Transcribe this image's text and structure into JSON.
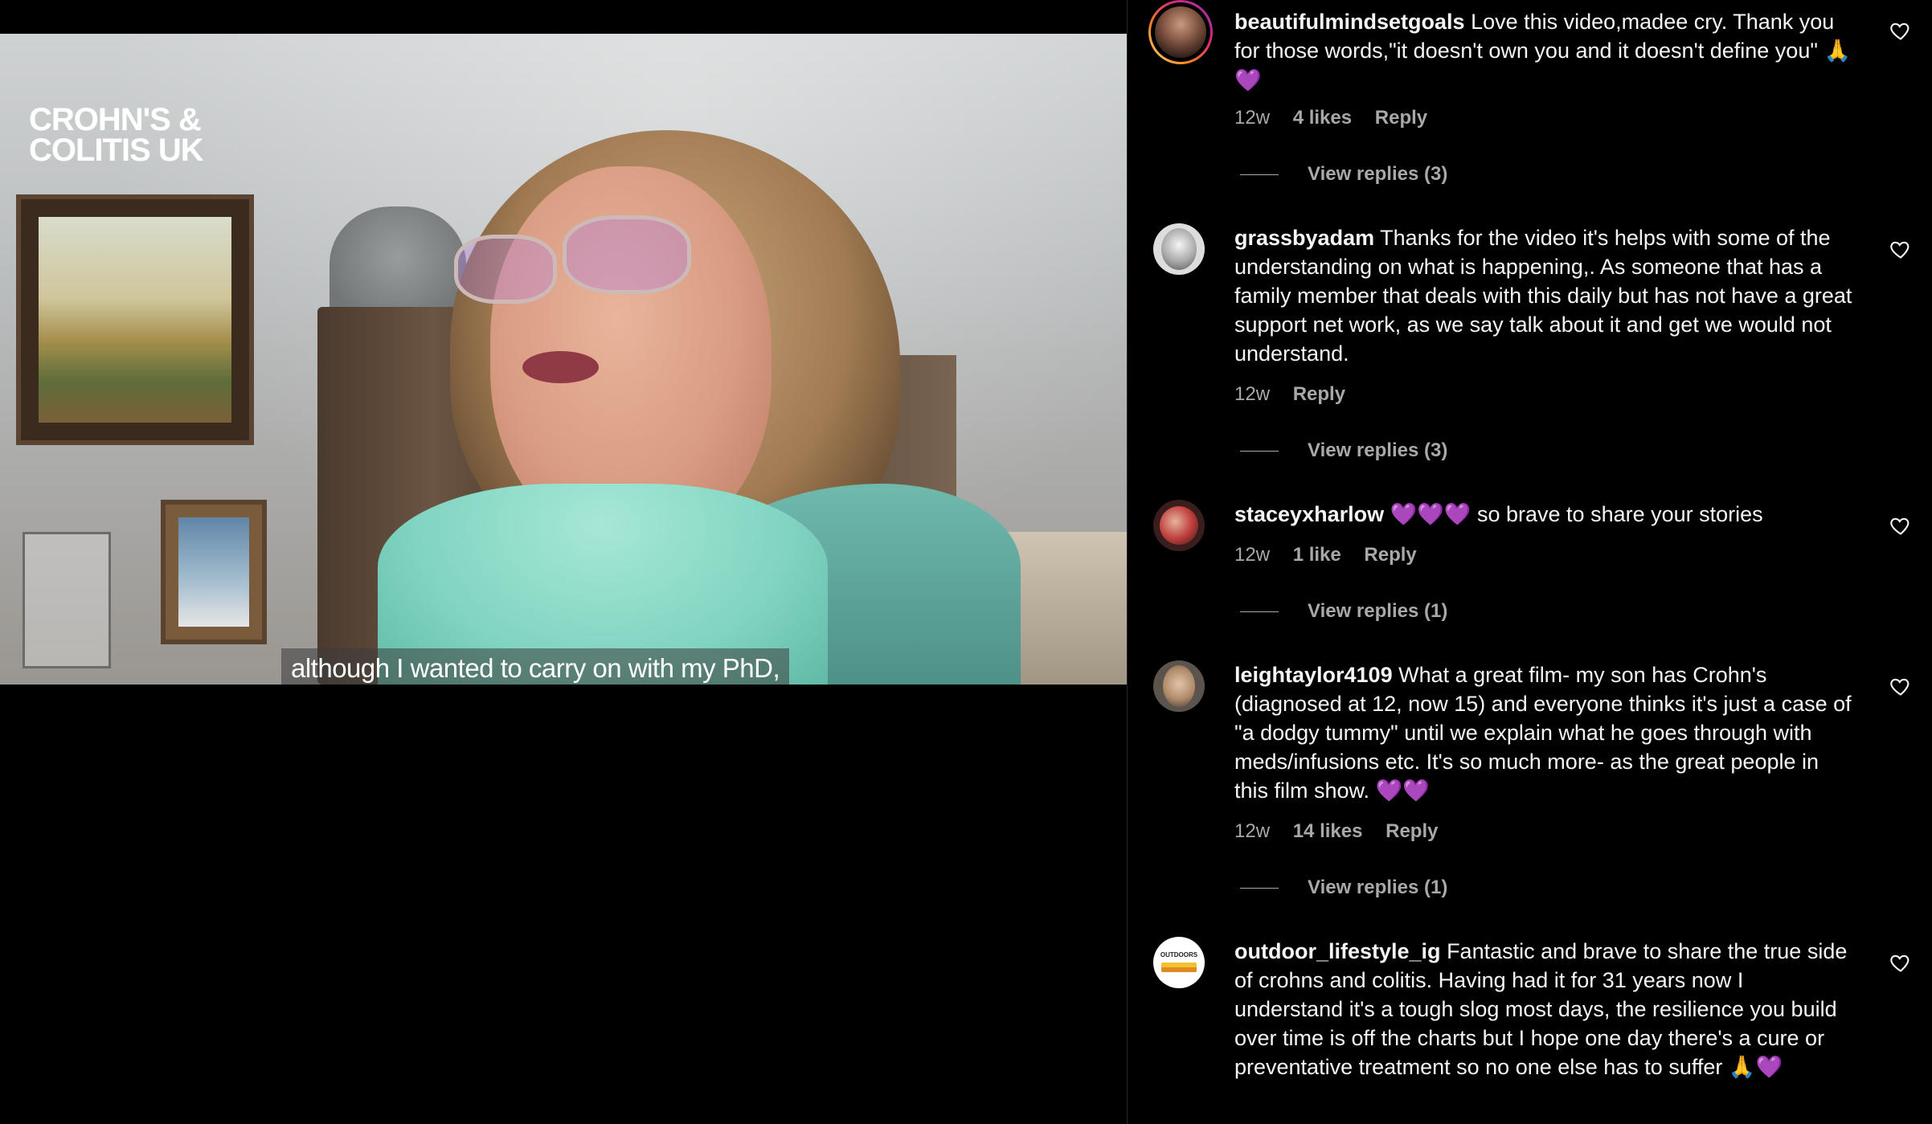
{
  "video": {
    "brand_line1": "CROHN'S &",
    "brand_line2": "COLITIS UK",
    "subtitle": "although I wanted to carry on with my PhD,"
  },
  "comments": [
    {
      "username": "beautifulmindsetgoals",
      "text": "Love this video,madee cry. Thank you for those words,\"it doesn't own you and it doesn't define you\"",
      "emojis": "🙏💜",
      "time": "12w",
      "likes": "4 likes",
      "reply": "Reply",
      "view_replies": "View replies (3)"
    },
    {
      "username": "grassbyadam",
      "text": "Thanks for the video it's helps with some of the understanding on what is happening,. As someone that has a family member that deals with this daily but has not have a great support net work, as we say talk about it and get we would not understand.",
      "emojis": "",
      "time": "12w",
      "likes": "",
      "reply": "Reply",
      "view_replies": "View replies (3)"
    },
    {
      "username": "staceyxharlow",
      "text": "so brave to share your stories",
      "emojis_before": "💜💜💜",
      "time": "12w",
      "likes": "1 like",
      "reply": "Reply",
      "view_replies": "View replies (1)"
    },
    {
      "username": "leightaylor4109",
      "text": "What a great film- my son has Crohn's (diagnosed at 12, now 15) and everyone thinks it's just a case of \"a dodgy tummy\" until we explain what he goes through with meds/infusions etc. It's so much more- as the great people in this film show.",
      "emojis": "💜💜",
      "time": "12w",
      "likes": "14 likes",
      "reply": "Reply",
      "view_replies": "View replies (1)"
    },
    {
      "username": "outdoor_lifestyle_ig",
      "avatar_label": "OUTDOORS",
      "text": "Fantastic and brave to share the true side of crohns and colitis. Having had it for 31 years now I understand it's a tough slog most days, the resilience you build over time is off the charts but I hope one day there's a cure or preventative treatment so no one else has to suffer",
      "emojis": "🙏💜"
    }
  ],
  "icons": {
    "like": "heart-outline-icon"
  },
  "colors": {
    "background": "#000000",
    "text": "#f5f5f5",
    "muted": "#a8a8a8",
    "emoji_heart": "#b44cf0"
  }
}
